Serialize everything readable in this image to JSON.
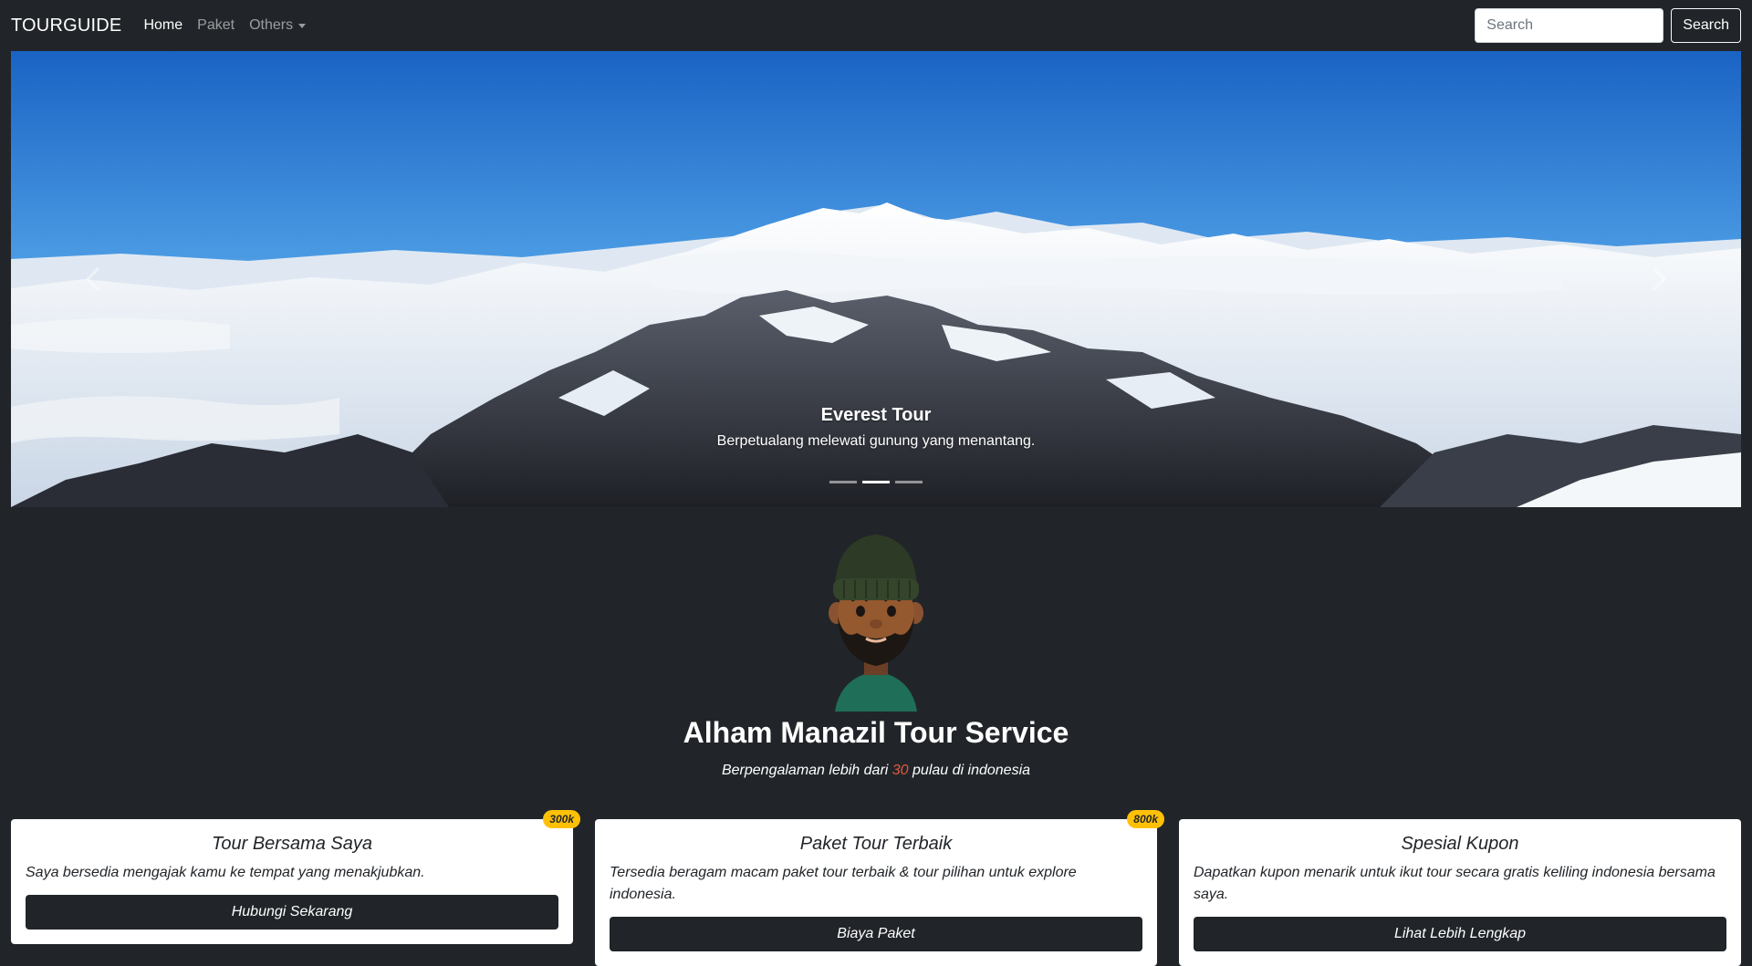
{
  "navbar": {
    "brand": "TOURGUIDE",
    "links": [
      {
        "label": "Home",
        "active": true
      },
      {
        "label": "Paket",
        "active": false
      },
      {
        "label": "Others",
        "active": false,
        "dropdown": true
      }
    ],
    "search_placeholder": "Search",
    "search_button": "Search"
  },
  "carousel": {
    "slide_title": "Everest Tour",
    "slide_text": "Berpetualang melewati gunung yang menantang.",
    "indicator_count": 3,
    "active_indicator": 1,
    "prev_icon": "chevron-left-icon",
    "next_icon": "chevron-right-icon"
  },
  "profile": {
    "name": "Alham Manazil Tour Service",
    "tagline_before": "Berpengalaman lebih dari ",
    "tagline_number": "30",
    "tagline_after": " pulau di indonesia",
    "highlight_color": "#e25a3f"
  },
  "cards": [
    {
      "title": "Tour Bersama Saya",
      "text": "Saya bersedia mengajak kamu ke tempat yang menakjubkan.",
      "button": "Hubungi Sekarang",
      "badge": "300k"
    },
    {
      "title": "Paket Tour Terbaik",
      "text": "Tersedia beragam macam paket tour terbaik & tour pilihan untuk explore indonesia.",
      "button": "Biaya Paket",
      "badge": "800k"
    },
    {
      "title": "Spesial Kupon",
      "text": "Dapatkan kupon menarik untuk ikut tour secara gratis keliling indonesia bersama saya.",
      "button": "Lihat Lebih Lengkap",
      "badge": ""
    }
  ],
  "colors": {
    "background": "#212529",
    "badge": "#ffc107",
    "accent": "#e25a3f"
  }
}
